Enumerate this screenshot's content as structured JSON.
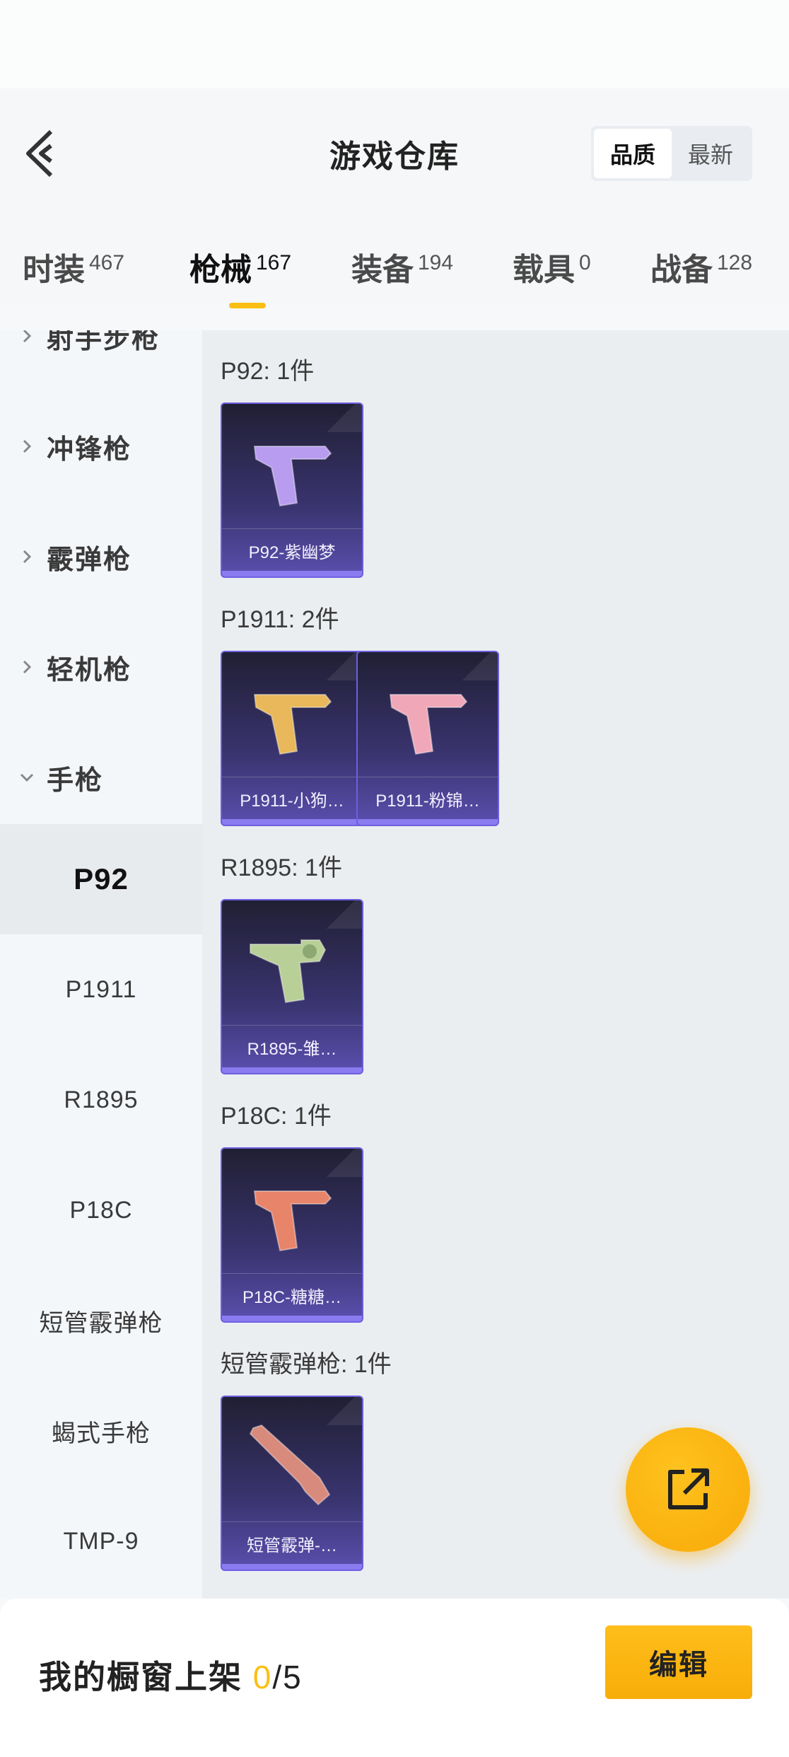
{
  "header": {
    "title": "游戏仓库",
    "sort_options": [
      "品质",
      "最新"
    ],
    "sort_selected": "品质"
  },
  "tabs": [
    {
      "label": "时装",
      "count": "467"
    },
    {
      "label": "枪械",
      "count": "167",
      "active": true
    },
    {
      "label": "装备",
      "count": "194"
    },
    {
      "label": "载具",
      "count": "0"
    },
    {
      "label": "战备",
      "count": "128"
    }
  ],
  "sidebar": {
    "categories": [
      {
        "label": "射手步枪",
        "expanded": false
      },
      {
        "label": "冲锋枪",
        "expanded": false
      },
      {
        "label": "霰弹枪",
        "expanded": false
      },
      {
        "label": "轻机枪",
        "expanded": false
      },
      {
        "label": "手枪",
        "expanded": true
      }
    ],
    "subitems": [
      {
        "label": "P92",
        "active": true
      },
      {
        "label": "P1911"
      },
      {
        "label": "R1895"
      },
      {
        "label": "P18C"
      },
      {
        "label": "短管霰弹枪"
      },
      {
        "label": "蝎式手枪"
      },
      {
        "label": "TMP-9"
      }
    ]
  },
  "groups": [
    {
      "label": "P92: 1件",
      "items": [
        {
          "name": "P92-紫幽梦",
          "color": "#b89cf0"
        }
      ]
    },
    {
      "label": "P1911: 2件",
      "items": [
        {
          "name": "P1911-小狗…",
          "color": "#e8b85a"
        },
        {
          "name": "P1911-粉锦…",
          "color": "#f0a8b8"
        }
      ]
    },
    {
      "label": "R1895: 1件",
      "items": [
        {
          "name": "R1895-雏…",
          "color": "#b8cf98"
        }
      ]
    },
    {
      "label": "P18C: 1件",
      "items": [
        {
          "name": "P18C-糖糖…",
          "color": "#e8846a"
        }
      ]
    },
    {
      "label": "短管霰弹枪: 1件",
      "items": [
        {
          "name": "短管霰弹-…",
          "color": "#d88a7c"
        }
      ]
    }
  ],
  "footer": {
    "label": "我的橱窗上架",
    "current": "0",
    "total": "/5",
    "edit_label": "编辑"
  },
  "colors": {
    "accent": "#fbbf14",
    "card_border": "#6d5fe0"
  }
}
